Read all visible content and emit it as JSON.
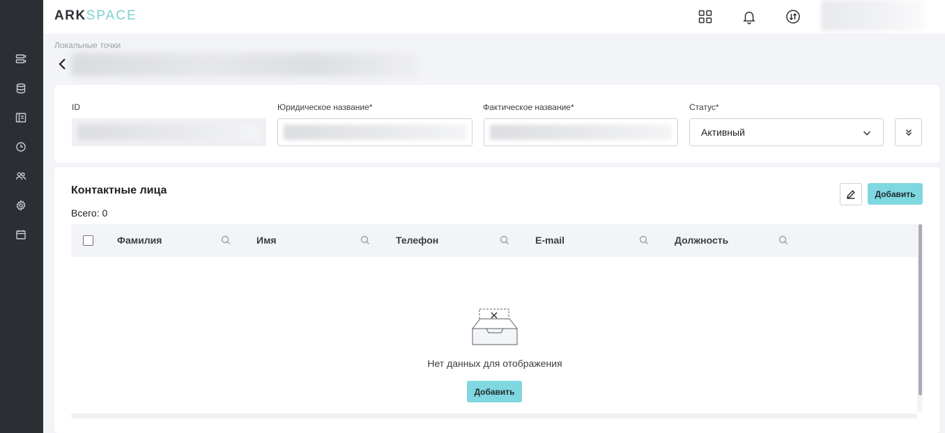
{
  "header": {
    "logo_ark": "ARK",
    "logo_space": "SPACE",
    "icons": [
      "apps-grid-icon",
      "bell-icon",
      "switch-arrows-icon"
    ]
  },
  "sidebar": {
    "icons": [
      "server-list-icon",
      "database-icon",
      "layout-icon",
      "clock-icon",
      "users-icon",
      "settings-gear-icon",
      "calendar-icon"
    ]
  },
  "breadcrumb": {
    "label": "Локальные точки"
  },
  "details": {
    "id_label": "ID",
    "legal_name_label": "Юридическое название*",
    "actual_name_label": "Фактическое название*",
    "status_label": "Статус*",
    "status_value": "Активный"
  },
  "contacts": {
    "title": "Контактные лица",
    "total": "Всего: 0",
    "add_label": "Добавить",
    "columns": [
      "Фамилия",
      "Имя",
      "Телефон",
      "E-mail",
      "Должность"
    ],
    "empty_text": "Нет данных для отображения",
    "empty_add_label": "Добавить"
  },
  "colors": {
    "sidebar_bg": "#2b2e33",
    "accent": "#7fd7e0",
    "page_bg": "#f3f4f8"
  }
}
